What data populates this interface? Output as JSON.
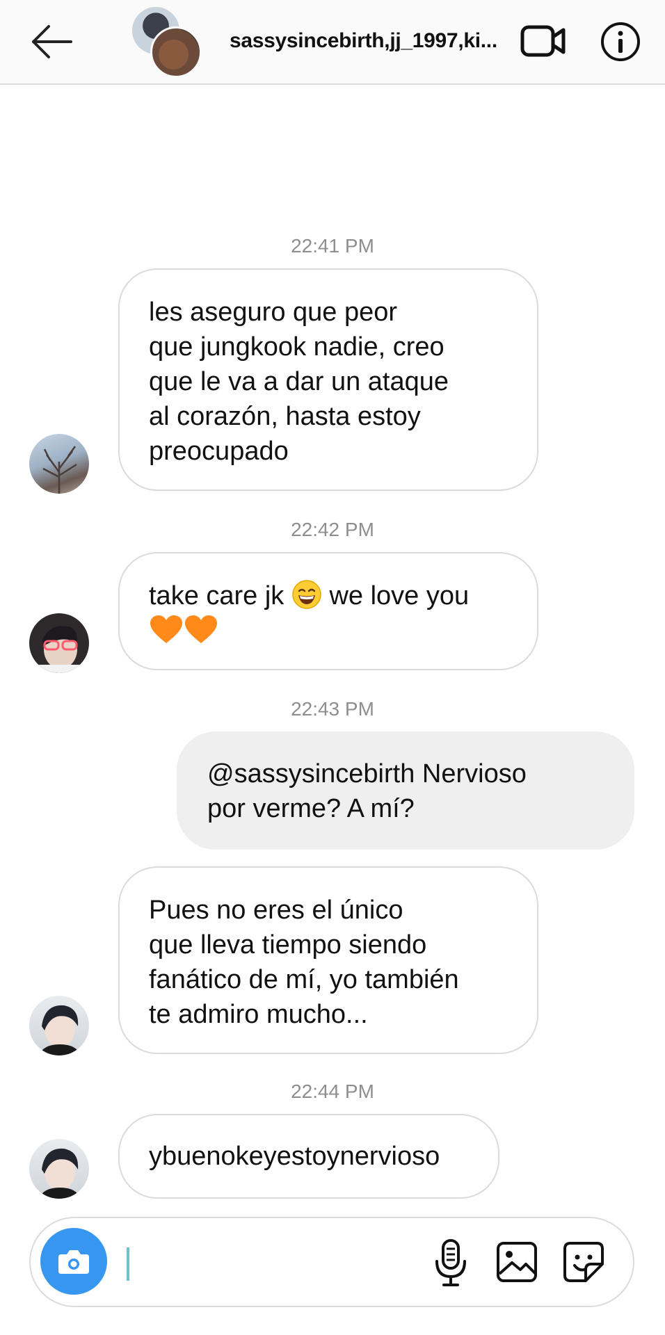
{
  "header": {
    "title": "sassysincebirth,jj_1997,ki...",
    "icons": [
      "back-arrow-icon",
      "video-call-icon",
      "info-icon"
    ]
  },
  "messages": [
    {
      "timestamp": "22:41 PM",
      "sender": "other",
      "lines": [
        "les aseguro que peor",
        "que jungkook nadie, creo",
        "que le va a dar un ataque",
        "al corazón, hasta estoy",
        "preocupado"
      ]
    },
    {
      "timestamp": "22:42 PM",
      "sender": "other",
      "text_before": "take care jk",
      "emoji_1": "grinning-face-emoji",
      "text_after": "we love you",
      "emoji_2": "orange-heart-emoji"
    },
    {
      "timestamp": "22:43 PM",
      "sender": "me",
      "lines": [
        "@sassysincebirth Nervioso",
        "por verme? A mí?"
      ]
    },
    {
      "sender": "other",
      "lines": [
        "Pues no eres el único",
        "que lleva tiempo siendo",
        "fanático de mí, yo también",
        "te admiro mucho..."
      ]
    },
    {
      "timestamp": "22:44 PM",
      "sender": "other",
      "lines": [
        "ybuenokeyestoynervioso"
      ]
    }
  ],
  "composer": {
    "placeholder": "",
    "icons": [
      "camera-icon",
      "microphone-icon",
      "gallery-icon",
      "sticker-icon"
    ]
  },
  "colors": {
    "accent": "#3797f0",
    "own_bubble": "#efefef",
    "timestamp": "#8e8e8e"
  }
}
